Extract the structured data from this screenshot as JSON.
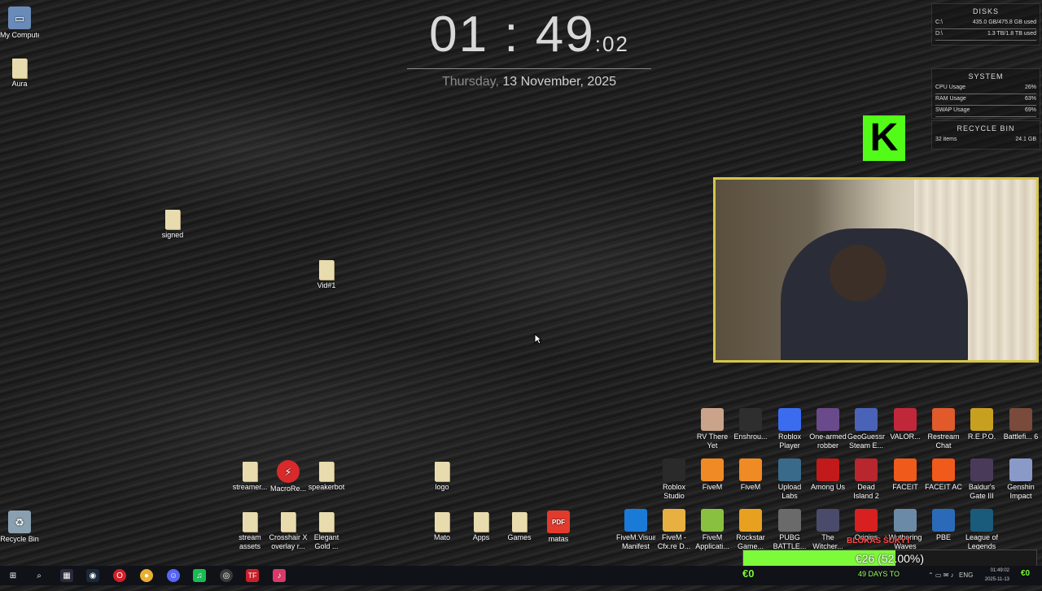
{
  "clock": {
    "time": "01 : 49",
    "seconds": ":02",
    "weekday": "Thursday,",
    "date": "13 November, 2025"
  },
  "widgets": {
    "disks": {
      "title": "DISKS",
      "rows": [
        {
          "label": "C:\\",
          "value": "435.0 GB/475.8 GB used"
        },
        {
          "label": "D:\\",
          "value": "1.3 TB/1.8 TB used"
        }
      ]
    },
    "system": {
      "title": "SYSTEM",
      "rows": [
        {
          "label": "CPU Usage",
          "value": "26%"
        },
        {
          "label": "RAM Usage",
          "value": "63%"
        },
        {
          "label": "SWAP Usage",
          "value": "69%"
        }
      ]
    },
    "recycle": {
      "title": "RECYCLE BIN",
      "items": "32 items",
      "size": "24.1 GB"
    }
  },
  "desktop_left": [
    {
      "label": "My Computer",
      "icon": "computer-icon"
    },
    {
      "label": "Aura",
      "icon": "folder-icon"
    },
    {
      "label": "signed",
      "icon": "folder-icon"
    },
    {
      "label": "Vid#1",
      "icon": "folder-icon"
    },
    {
      "label": "Recycle Bin",
      "icon": "recycle-bin-icon"
    }
  ],
  "desktop_mid": [
    {
      "label": "streamer...",
      "icon": "folder-icon"
    },
    {
      "label": "MacroRe...",
      "icon": "macro-icon"
    },
    {
      "label": "speakerbot",
      "icon": "folder-icon"
    },
    {
      "label": "logo",
      "icon": "folder-icon"
    },
    {
      "label": "stream assets",
      "icon": "folder-icon"
    },
    {
      "label": "Crosshair X overlay r...",
      "icon": "folder-icon"
    },
    {
      "label": "Elegant Gold ...",
      "icon": "folder-icon"
    },
    {
      "label": "Mato",
      "icon": "folder-icon"
    },
    {
      "label": "Apps",
      "icon": "folder-icon"
    },
    {
      "label": "Games",
      "icon": "folder-icon"
    },
    {
      "label": "matas",
      "icon": "pdf-icon"
    }
  ],
  "desktop_right": [
    {
      "label": "RV There Yet",
      "color": "#c9a38a"
    },
    {
      "label": "Enshrou...",
      "color": "#2e2e2e"
    },
    {
      "label": "Roblox Player",
      "color": "#3b6cf0"
    },
    {
      "label": "One-armed robber",
      "color": "#6a4a8a"
    },
    {
      "label": "GeoGuessr Steam E...",
      "color": "#4a63b8"
    },
    {
      "label": "VALOR...",
      "color": "#c0283a"
    },
    {
      "label": "Restream Chat",
      "color": "#e05a2c"
    },
    {
      "label": "R.E.P.O.",
      "color": "#c8a020"
    },
    {
      "label": "Battlefi... 6",
      "color": "#7a4a3a"
    },
    {
      "label": "Roblox Studio",
      "color": "#2a2a2a"
    },
    {
      "label": "FiveM",
      "color": "#f08a24"
    },
    {
      "label": "FiveM",
      "color": "#f08a24"
    },
    {
      "label": "Upload Labs",
      "color": "#3a6a8a"
    },
    {
      "label": "Among Us",
      "color": "#c21a1a"
    },
    {
      "label": "Dead Island 2",
      "color": "#b8262e"
    },
    {
      "label": "FACEIT",
      "color": "#f05a1a"
    },
    {
      "label": "FACEIT AC",
      "color": "#f05a1a"
    },
    {
      "label": "Baldur's Gate III",
      "color": "#4a3a5a"
    },
    {
      "label": "Genshin Impact",
      "color": "#8a9ac8"
    },
    {
      "label": "FiveM.VisualElements Manifest",
      "color": "#1a7ad8"
    },
    {
      "label": "FiveM - Cfx.re D...",
      "color": "#e8b040"
    },
    {
      "label": "FiveM Applicati...",
      "color": "#8ac040"
    },
    {
      "label": "Rockstar Game...",
      "color": "#e8a020"
    },
    {
      "label": "PUBG BATTLE...",
      "color": "#6a6a6a"
    },
    {
      "label": "The Witcher...",
      "color": "#4a4a6a"
    },
    {
      "label": "Origins",
      "color": "#d82020"
    },
    {
      "label": "Wuthering Waves",
      "color": "#6a8aa8"
    },
    {
      "label": "PBE",
      "color": "#2a6ab8"
    },
    {
      "label": "League of Legends",
      "color": "#1a5a7a"
    }
  ],
  "overlay": {
    "goal_title": "BLOKAS ŠUKYT",
    "goal_amount": "€26 (52.00%)",
    "goal_fraction": 0.52,
    "euro_left": "€0",
    "euro_right": "€0",
    "days_text": "49 DAYS TO"
  },
  "taskbar": {
    "apps": [
      "windows-start-icon",
      "search-icon",
      "task-view-icon",
      "steam-icon",
      "opera-icon",
      "chrome-icon",
      "discord-icon",
      "spotify-icon",
      "obs-icon",
      "tf-icon",
      "tiktok-icon"
    ],
    "lang": "ENG",
    "time": "01:49:02",
    "date": "2025-11-13"
  },
  "colors": {
    "accent_green": "#53fc18",
    "frame_gold": "#d4c54a"
  }
}
